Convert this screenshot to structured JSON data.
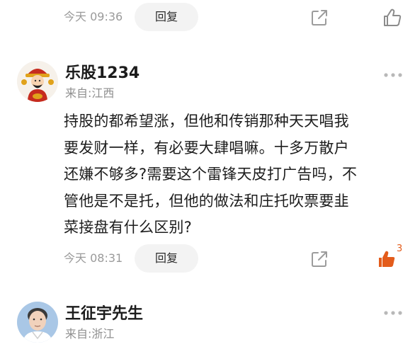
{
  "top_action_bar": {
    "time": "今天 09:36",
    "reply_label": "回复"
  },
  "comments": [
    {
      "username": "乐股1234",
      "location": "来自:江西",
      "avatar": "fortune-god-avatar",
      "body_lines": [
        "持股的都希望涨，但他和传销那种天天唱我",
        "要发财一样，有必要大肆唱嘛。十多万散户",
        "还嫌不够多?需要这个雷锋天皮打广告吗，不",
        "管他是不是托，但他的做法和庄托吹票要韭",
        "菜接盘有什么区别?"
      ],
      "time": "今天 08:31",
      "reply_label": "回复",
      "like_count": "3",
      "liked": true
    },
    {
      "username": "王征宇先生",
      "location": "来自:浙江",
      "avatar": "man-portrait-avatar"
    }
  ],
  "icons": {
    "share": "share-icon",
    "like": "thumbs-up-icon",
    "more": "more-dots-icon"
  },
  "colors": {
    "liked": "#e35c1b",
    "muted_text": "#9a9a9a",
    "reply_bg": "#f3f3f3"
  }
}
